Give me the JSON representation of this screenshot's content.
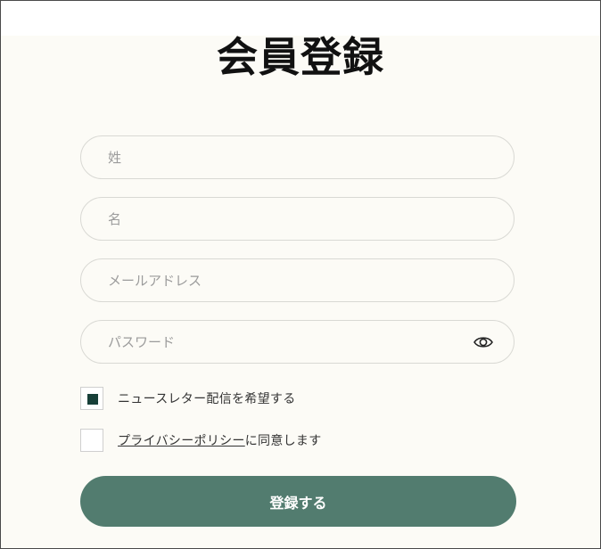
{
  "page": {
    "title": "会員登録"
  },
  "form": {
    "last_name_placeholder": "姓",
    "first_name_placeholder": "名",
    "email_placeholder": "メールアドレス",
    "password_placeholder": "パスワード",
    "password_toggle_icon": "eye-icon"
  },
  "options": {
    "newsletter_label": "ニュースレター配信を希望する",
    "newsletter_checked": true,
    "privacy_link": "プライバシーポリシー",
    "privacy_suffix": "に同意します",
    "privacy_checked": false
  },
  "actions": {
    "submit_label": "登録する"
  },
  "colors": {
    "background": "#fcfbf6",
    "primary_button": "#527c6f",
    "checkbox_mark": "#173f38"
  }
}
